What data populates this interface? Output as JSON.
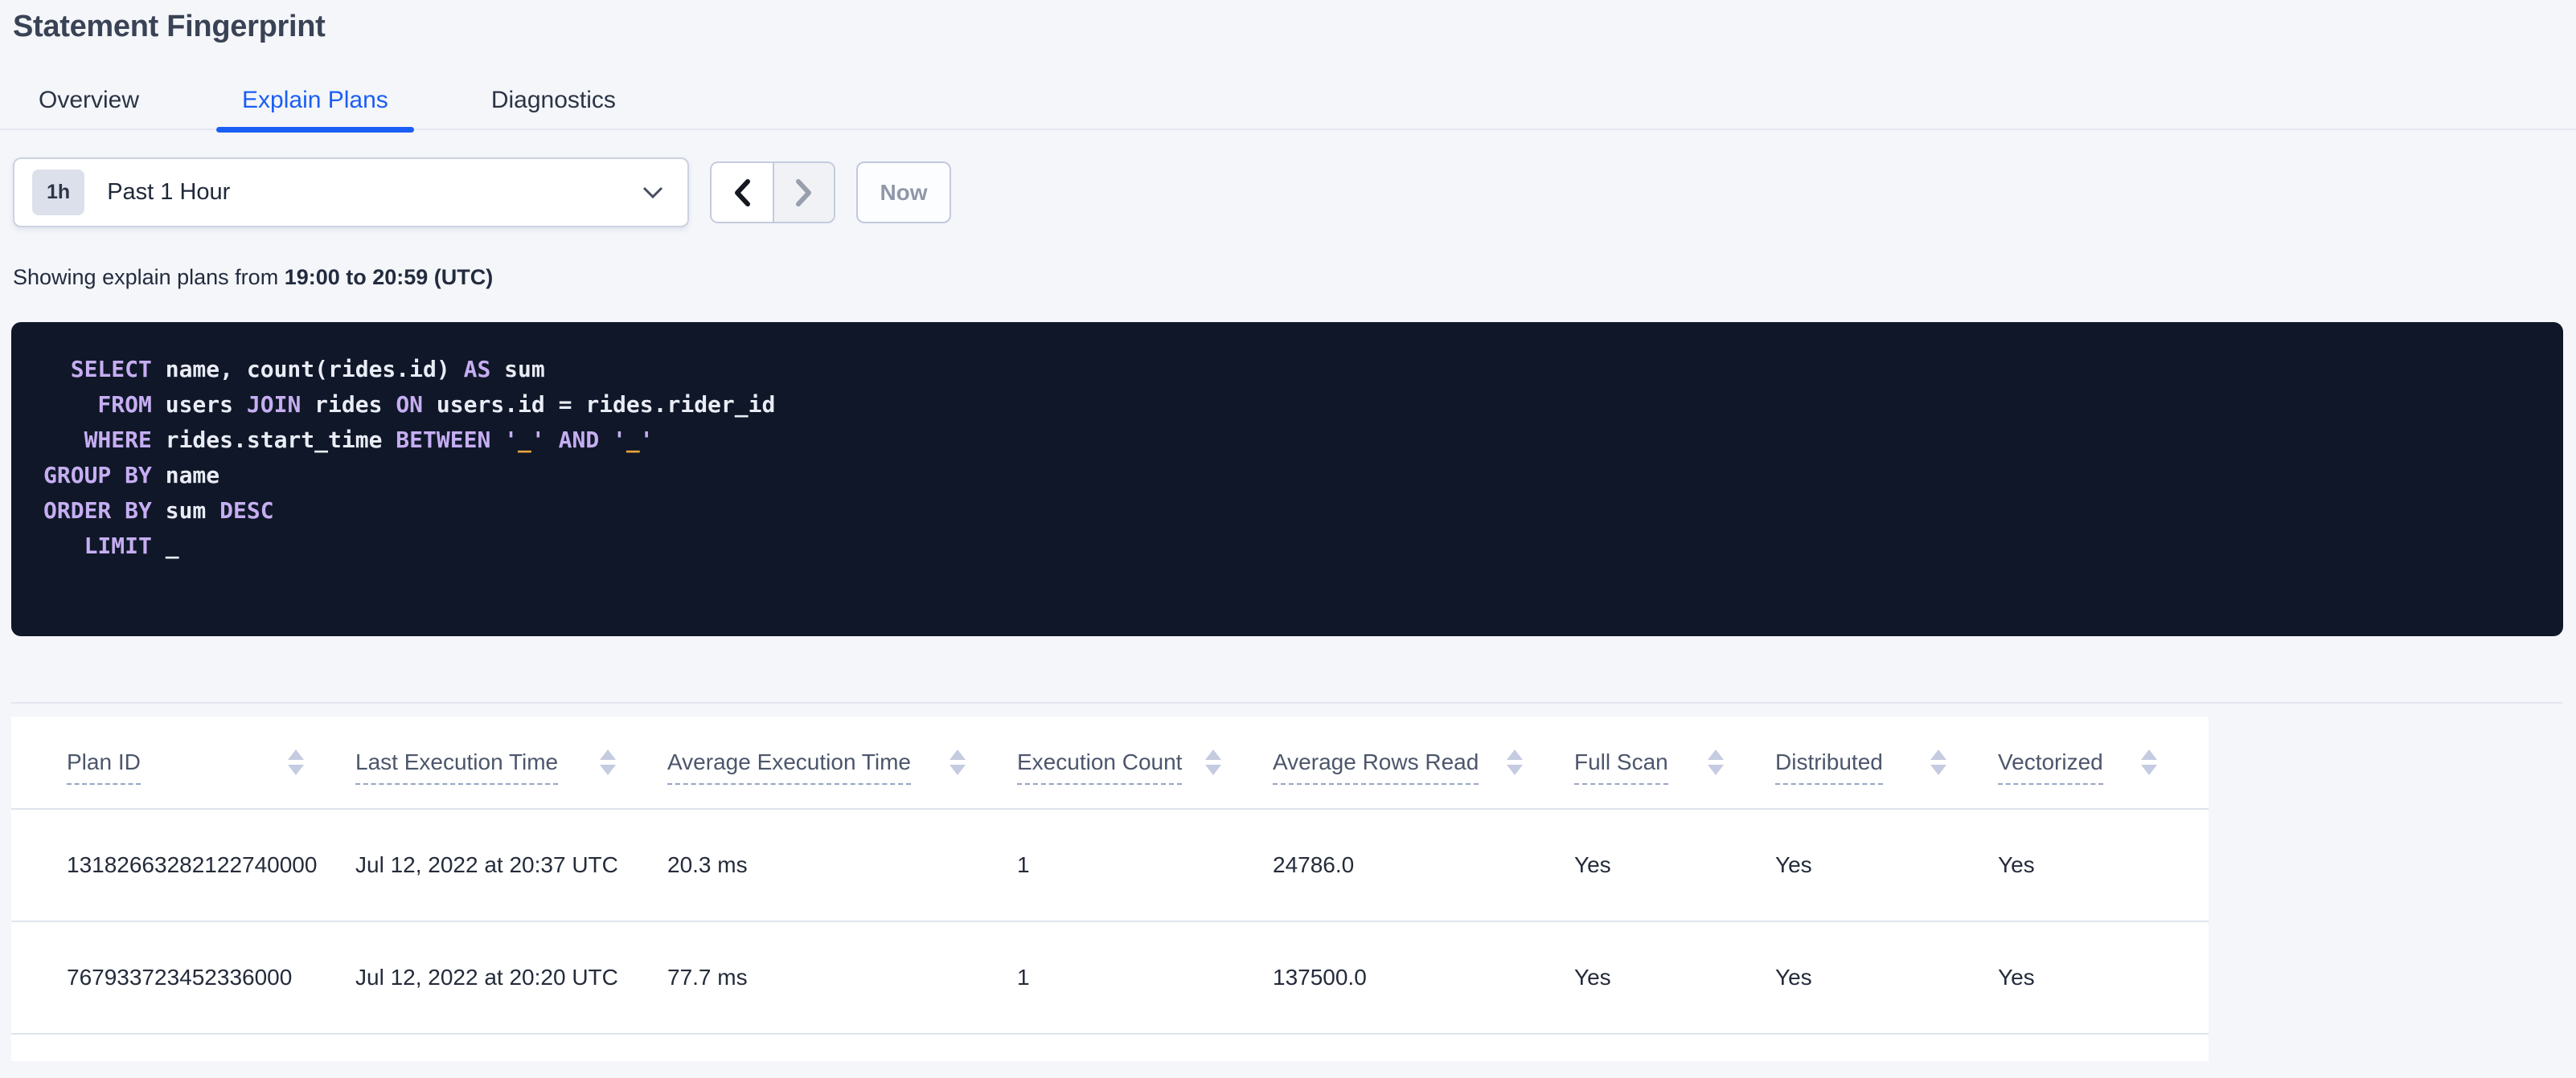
{
  "page": {
    "title": "Statement Fingerprint"
  },
  "tabs": [
    {
      "label": "Overview",
      "active": false
    },
    {
      "label": "Explain Plans",
      "active": true
    },
    {
      "label": "Diagnostics",
      "active": false
    }
  ],
  "time_picker": {
    "badge": "1h",
    "label": "Past 1 Hour",
    "now_label": "Now",
    "icons": {
      "open": "chevron-down-icon",
      "prev": "chevron-left-icon",
      "next": "chevron-right-icon"
    },
    "prev_enabled": true,
    "next_enabled": false
  },
  "status_line": {
    "prefix": "Showing explain plans from ",
    "range": "19:00 to 20:59 (UTC)"
  },
  "sql": {
    "lines": [
      [
        [
          "kw",
          "  SELECT"
        ],
        [
          "id",
          " name, count(rides.id) "
        ],
        [
          "kw",
          "AS"
        ],
        [
          "id",
          " sum"
        ]
      ],
      [
        [
          "kw",
          "    FROM"
        ],
        [
          "id",
          " users "
        ],
        [
          "kw",
          "JOIN"
        ],
        [
          "id",
          " rides "
        ],
        [
          "kw",
          "ON"
        ],
        [
          "id",
          " users.id = rides.rider_id"
        ]
      ],
      [
        [
          "kw",
          "   WHERE"
        ],
        [
          "id",
          " rides.start_time "
        ],
        [
          "kw",
          "BETWEEN"
        ],
        [
          "id",
          " "
        ],
        [
          "kw",
          "'"
        ],
        [
          "lit",
          "_"
        ],
        [
          "kw",
          "'"
        ],
        [
          "id",
          " "
        ],
        [
          "kw",
          "AND"
        ],
        [
          "id",
          " "
        ],
        [
          "kw",
          "'"
        ],
        [
          "lit",
          "_"
        ],
        [
          "kw",
          "'"
        ]
      ],
      [
        [
          "kw",
          "GROUP BY"
        ],
        [
          "id",
          " name"
        ]
      ],
      [
        [
          "kw",
          "ORDER BY"
        ],
        [
          "id",
          " sum "
        ],
        [
          "kw",
          "DESC"
        ]
      ],
      [
        [
          "kw",
          "   LIMIT"
        ],
        [
          "id",
          " _"
        ]
      ]
    ]
  },
  "table": {
    "columns": [
      {
        "label": "Plan ID",
        "sortable": true
      },
      {
        "label": "Last Execution Time",
        "sortable": true
      },
      {
        "label": "Average Execution Time",
        "sortable": true
      },
      {
        "label": "Execution Count",
        "sortable": true
      },
      {
        "label": "Average Rows Read",
        "sortable": true
      },
      {
        "label": "Full Scan",
        "sortable": true
      },
      {
        "label": "Distributed",
        "sortable": true
      },
      {
        "label": "Vectorized",
        "sortable": true
      }
    ],
    "rows": [
      [
        "13182663282122740000",
        "Jul 12, 2022 at 20:37 UTC",
        "20.3 ms",
        "1",
        "24786.0",
        "Yes",
        "Yes",
        "Yes"
      ],
      [
        "767933723452336000",
        "Jul 12, 2022 at 20:20 UTC",
        "77.7 ms",
        "1",
        "137500.0",
        "Yes",
        "Yes",
        "Yes"
      ]
    ]
  },
  "colors": {
    "page_background": "#f4f6fa",
    "accent_blue": "#1b5ef5",
    "sql_background": "#0f1728",
    "sql_keyword": "#c6aef2",
    "sql_identifier": "#e9ecf5",
    "sql_literal": "#e9a43c",
    "header_text": "#4c566b",
    "cell_text": "#242b3a",
    "disabled_text": "#8f97a9"
  }
}
